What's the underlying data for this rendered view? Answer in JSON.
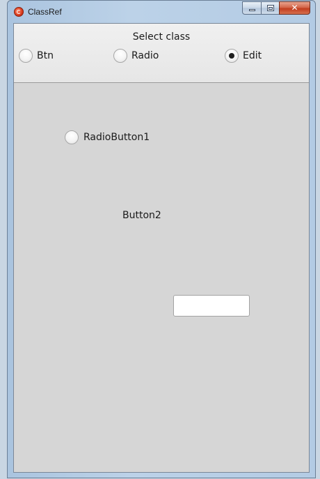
{
  "window": {
    "title": "ClassRef",
    "icon": "app-icon",
    "close_glyph": "✕"
  },
  "class_selector": {
    "label": "Select class",
    "options": [
      {
        "label": "Btn",
        "checked": false
      },
      {
        "label": "Radio",
        "checked": false
      },
      {
        "label": "Edit",
        "checked": true
      }
    ]
  },
  "canvas": {
    "radio_button": {
      "label": "RadioButton1",
      "checked": false
    },
    "button": {
      "label": "Button2"
    },
    "edit": {
      "value": ""
    }
  }
}
